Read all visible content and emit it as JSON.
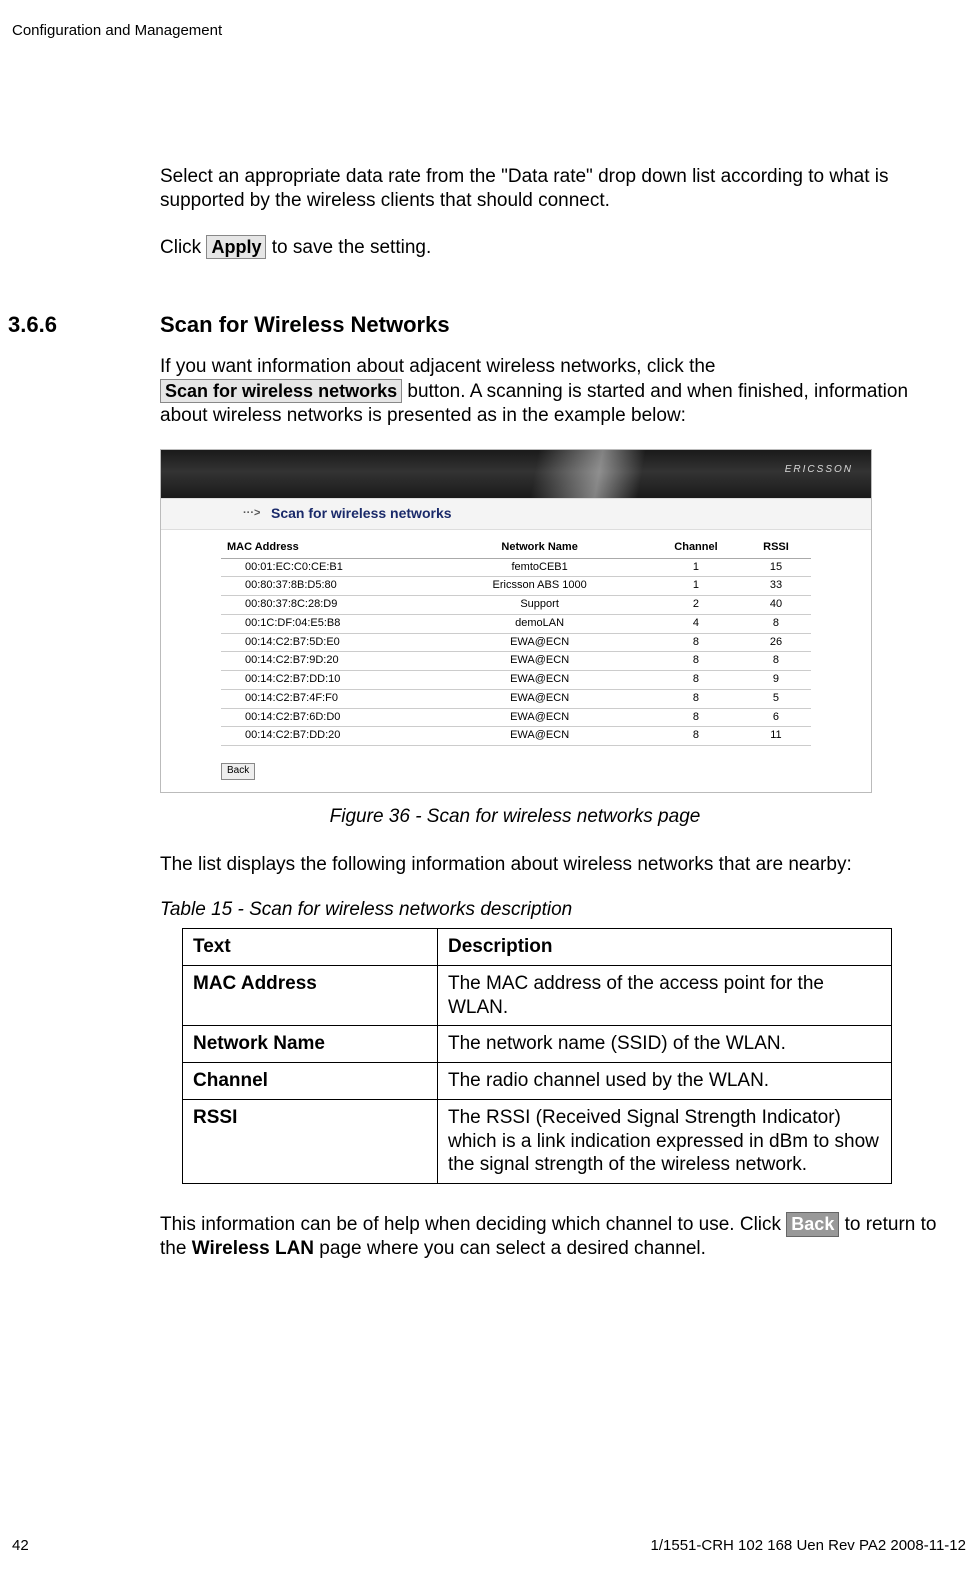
{
  "header": {
    "title": "Configuration and Management"
  },
  "section": {
    "number": "3.6.6",
    "title": "Scan for Wireless Networks"
  },
  "body": {
    "p1a": "Select an appropriate data rate from the \"Data rate\" drop down list according to what is supported by the wireless clients that should connect.",
    "p2a": "Click ",
    "p2b": " to save the setting.",
    "apply_label": "Apply",
    "p3a": "If you want information about adjacent wireless networks, click the ",
    "p3b": " button. A scanning is started and when finished, information about wireless networks is presented as in the example below:",
    "scan_btn_label": "Scan for wireless networks",
    "after_fig_p": "The list displays the following information about wireless networks that are nearby:",
    "p4a": "This information can be of help when deciding which channel to use. Click ",
    "p4b": " to return to the ",
    "p4c": " page where you can select a desired channel.",
    "back_label": "Back",
    "wlan_label": "Wireless LAN"
  },
  "figure": {
    "logo": "ERICSSON",
    "subhead": "Scan for wireless networks",
    "dots": "···>",
    "caption": "Figure 36 - Scan for wireless networks page",
    "back_btn": "Back",
    "columns": {
      "mac": "MAC Address",
      "name": "Network Name",
      "channel": "Channel",
      "rssi": "RSSI"
    },
    "rows": [
      {
        "mac": "00:01:EC:C0:CE:B1",
        "name": "femtoCEB1",
        "channel": "1",
        "rssi": "15"
      },
      {
        "mac": "00:80:37:8B:D5:80",
        "name": "Ericsson ABS 1000",
        "channel": "1",
        "rssi": "33"
      },
      {
        "mac": "00:80:37:8C:28:D9",
        "name": "Support",
        "channel": "2",
        "rssi": "40"
      },
      {
        "mac": "00:1C:DF:04:E5:B8",
        "name": "demoLAN",
        "channel": "4",
        "rssi": "8"
      },
      {
        "mac": "00:14:C2:B7:5D:E0",
        "name": "EWA@ECN",
        "channel": "8",
        "rssi": "26"
      },
      {
        "mac": "00:14:C2:B7:9D:20",
        "name": "EWA@ECN",
        "channel": "8",
        "rssi": "8"
      },
      {
        "mac": "00:14:C2:B7:DD:10",
        "name": "EWA@ECN",
        "channel": "8",
        "rssi": "9"
      },
      {
        "mac": "00:14:C2:B7:4F:F0",
        "name": "EWA@ECN",
        "channel": "8",
        "rssi": "5"
      },
      {
        "mac": "00:14:C2:B7:6D:D0",
        "name": "EWA@ECN",
        "channel": "8",
        "rssi": "6"
      },
      {
        "mac": "00:14:C2:B7:DD:20",
        "name": "EWA@ECN",
        "channel": "8",
        "rssi": "11"
      }
    ]
  },
  "desc_table": {
    "caption": "Table 15 - Scan for wireless networks description",
    "head": {
      "text": "Text",
      "desc": "Description"
    },
    "rows": [
      {
        "text": "MAC Address",
        "desc": "The MAC address of the access point for the WLAN."
      },
      {
        "text": "Network Name",
        "desc": "The network name (SSID) of the WLAN."
      },
      {
        "text": "Channel",
        "desc": "The radio channel used by the WLAN."
      },
      {
        "text": "RSSI",
        "desc": "The RSSI (Received Signal Strength Indicator) which is a link indication expressed in dBm to show the signal strength of the wireless network."
      }
    ]
  },
  "footer": {
    "page": "42",
    "docid": "1/1551-CRH 102 168 Uen Rev PA2  2008-11-12"
  }
}
